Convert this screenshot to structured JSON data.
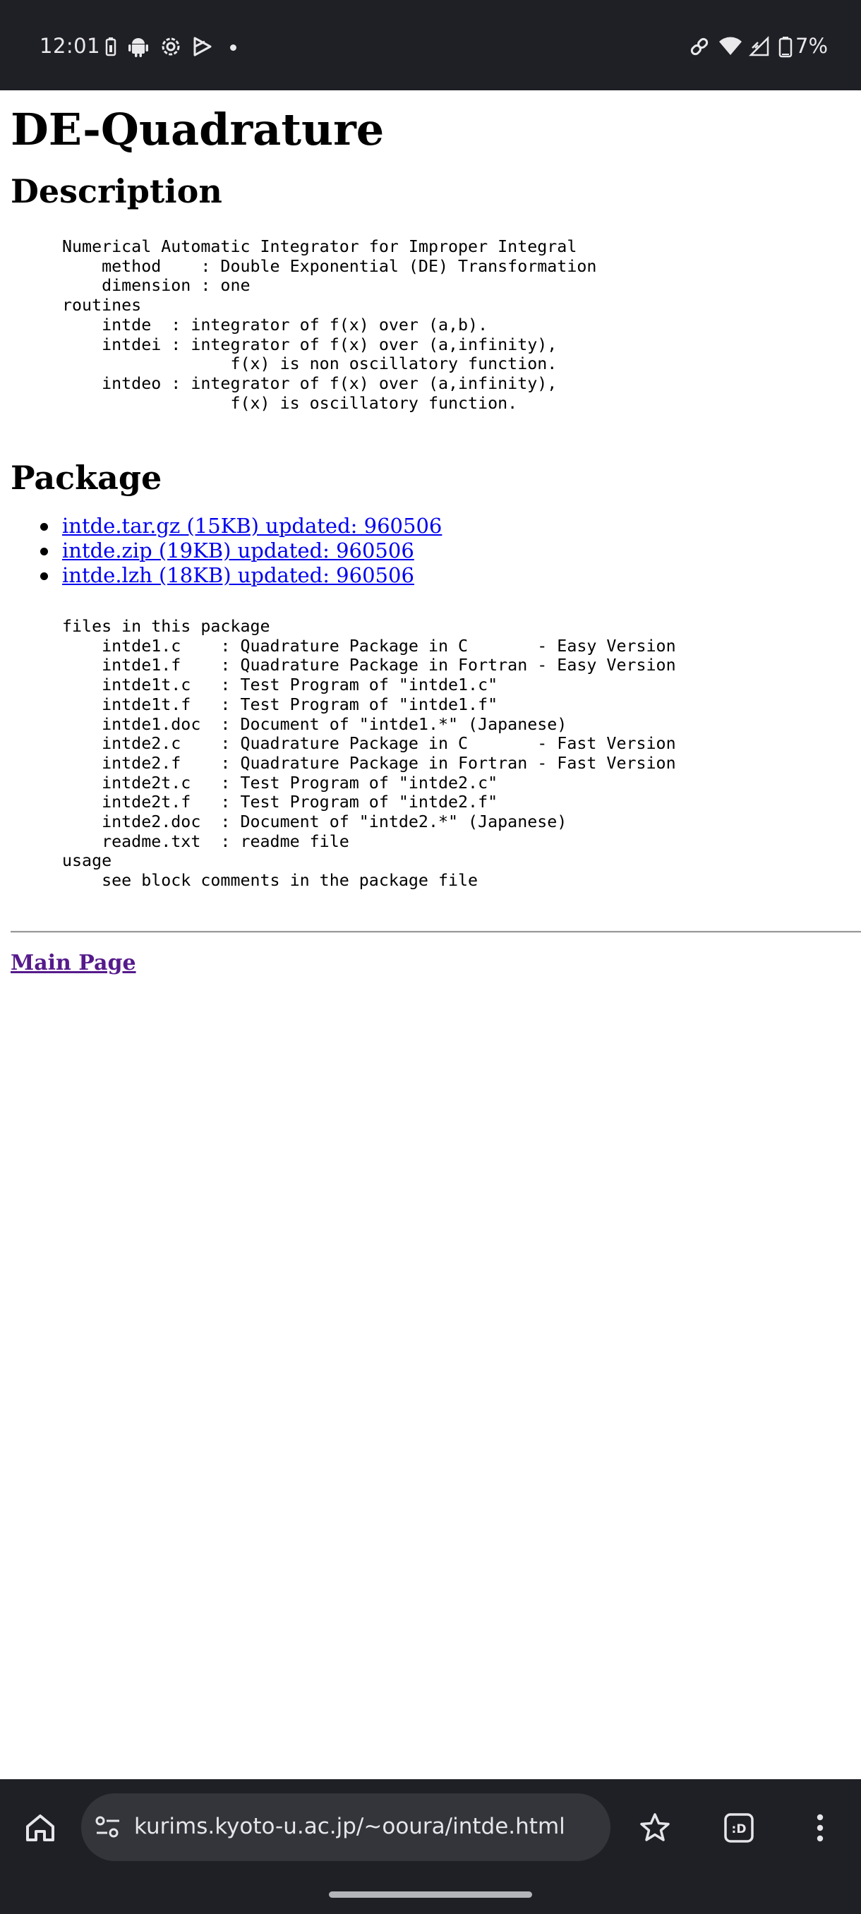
{
  "status_bar": {
    "time": "12:01",
    "battery_percent": "7%",
    "icons": [
      "battery-saver-icon",
      "android-icon",
      "settings-icon",
      "play-store-icon",
      "notification-dot-icon",
      "link-icon",
      "wifi-icon",
      "signal-icon",
      "battery-icon"
    ]
  },
  "page": {
    "title": "DE-Quadrature",
    "description_heading": "Description",
    "description_text": "Numerical Automatic Integrator for Improper Integral\n    method    : Double Exponential (DE) Transformation\n    dimension : one\nroutines\n    intde  : integrator of f(x) over (a,b).\n    intdei : integrator of f(x) over (a,infinity),\n                 f(x) is non oscillatory function.\n    intdeo : integrator of f(x) over (a,infinity),\n                 f(x) is oscillatory function.",
    "package_heading": "Package",
    "downloads": [
      "intde.tar.gz (15KB) updated: 960506",
      "intde.zip (19KB) updated: 960506",
      "intde.lzh (18KB) updated: 960506"
    ],
    "files_text": "files in this package\n    intde1.c    : Quadrature Package in C       - Easy Version\n    intde1.f    : Quadrature Package in Fortran - Easy Version\n    intde1t.c   : Test Program of \"intde1.c\"\n    intde1t.f   : Test Program of \"intde1.f\"\n    intde1.doc  : Document of \"intde1.*\" (Japanese)\n    intde2.c    : Quadrature Package in C       - Fast Version\n    intde2.f    : Quadrature Package in Fortran - Fast Version\n    intde2t.c   : Test Program of \"intde2.c\"\n    intde2t.f   : Test Program of \"intde2.f\"\n    intde2.doc  : Document of \"intde2.*\" (Japanese)\n    readme.txt  : readme file\nusage\n    see block comments in the package file",
    "main_page_link": "Main Page"
  },
  "browser": {
    "url": "kurims.kyoto-u.ac.jp/~ooura/intde.html",
    "tab_label": ":D"
  },
  "colors": {
    "bar_background": "#1f2025",
    "link": "#0000ee",
    "visited_link": "#551a8b"
  }
}
